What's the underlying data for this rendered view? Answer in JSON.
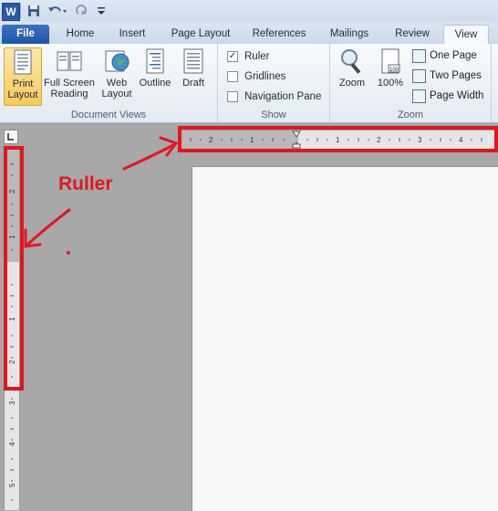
{
  "quick_access": {
    "app_icon_letter": "W"
  },
  "tabs": [
    {
      "label": "File"
    },
    {
      "label": "Home"
    },
    {
      "label": "Insert"
    },
    {
      "label": "Page Layout"
    },
    {
      "label": "References"
    },
    {
      "label": "Mailings"
    },
    {
      "label": "Review"
    },
    {
      "label": "View"
    }
  ],
  "ribbon": {
    "document_views": {
      "label": "Document Views",
      "buttons": [
        {
          "line1": "Print",
          "line2": "Layout"
        },
        {
          "line1": "Full Screen",
          "line2": "Reading"
        },
        {
          "line1": "Web",
          "line2": "Layout"
        },
        {
          "line1": "Outline",
          "line2": ""
        },
        {
          "line1": "Draft",
          "line2": ""
        }
      ]
    },
    "show": {
      "label": "Show",
      "items": [
        {
          "label": "Ruler",
          "checked": "✓"
        },
        {
          "label": "Gridlines",
          "checked": ""
        },
        {
          "label": "Navigation Pane",
          "checked": ""
        }
      ]
    },
    "zoom": {
      "label": "Zoom",
      "zoom_label": "Zoom",
      "percent_label": "100%",
      "one_page": "One Page",
      "two_pages": "Two Pages",
      "page_width": "Page Width"
    }
  },
  "rulers": {
    "horizontal_ticks": [
      "2",
      "1",
      "1",
      "2",
      "3",
      "4"
    ],
    "vertical_ticks": [
      "2",
      "1",
      "1",
      "2",
      "3",
      "4",
      "5"
    ]
  },
  "annotation": {
    "label": "Ruller",
    "color": "#e0171f"
  }
}
